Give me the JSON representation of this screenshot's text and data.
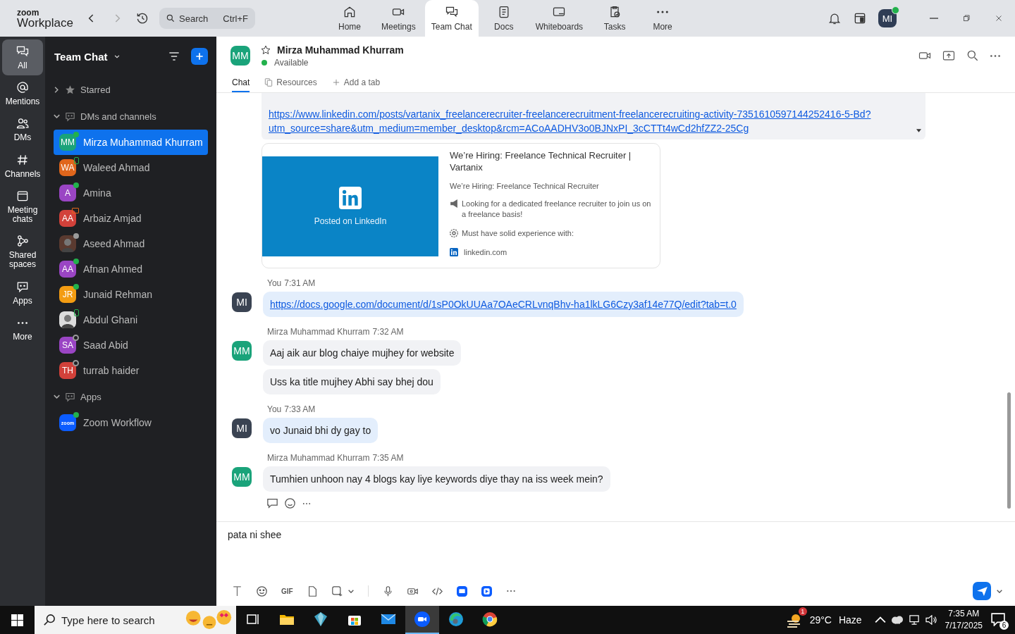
{
  "app": {
    "logo_top": "zoom",
    "logo": "Workplace",
    "search": {
      "placeholder": "Search",
      "shortcut": "Ctrl+F"
    },
    "user_initials": "MI",
    "user_online": true
  },
  "nav": [
    {
      "label": "Home",
      "selected": false
    },
    {
      "label": "Meetings",
      "selected": false
    },
    {
      "label": "Team Chat",
      "selected": true
    },
    {
      "label": "Docs",
      "selected": false
    },
    {
      "label": "Whiteboards",
      "selected": false
    },
    {
      "label": "Tasks",
      "selected": false
    },
    {
      "label": "More",
      "selected": false
    }
  ],
  "rail": [
    {
      "label": "All",
      "selected": true
    },
    {
      "label": "Mentions",
      "selected": false
    },
    {
      "label": "DMs",
      "selected": false
    },
    {
      "label": "Channels",
      "selected": false
    },
    {
      "label": "Meeting chats",
      "selected": false
    },
    {
      "label": "Shared spaces",
      "selected": false
    },
    {
      "label": "Apps",
      "selected": false
    },
    {
      "label": "More",
      "selected": false
    }
  ],
  "sidebar": {
    "title": "Team Chat",
    "sections": [
      {
        "label": "Starred",
        "expanded": false
      },
      {
        "label": "DMs and channels",
        "expanded": true,
        "items": [
          {
            "kind": "initials",
            "initials": "MM",
            "name": "Mirza Muhammad Khurram",
            "color": "#1aa37a",
            "status": {
              "kind": "dot",
              "color": "#22b14c"
            },
            "selected": true
          },
          {
            "kind": "initials",
            "initials": "WA",
            "name": "Waleed Ahmad",
            "color": "#e0661c",
            "status": {
              "kind": "phone",
              "color": "#22b14c"
            },
            "selected": false
          },
          {
            "kind": "initials",
            "initials": "A",
            "name": "Amina",
            "color": "#9a45c4",
            "status": {
              "kind": "dot",
              "color": "#22b14c"
            },
            "selected": false
          },
          {
            "kind": "initials",
            "initials": "AA",
            "name": "Arbaiz Amjad",
            "color": "#d2413a",
            "status": {
              "kind": "meeting",
              "color": "#e0661c"
            },
            "selected": false
          },
          {
            "name": "Aseed Ahmad",
            "color": "#5a3a30",
            "status": {
              "kind": "dot",
              "color": "#9a9a9a"
            },
            "selected": false
          },
          {
            "kind": "initials",
            "initials": "AA",
            "name": "Afnan Ahmed",
            "color": "#9a45c4",
            "status": {
              "kind": "dot",
              "color": "#22b14c"
            },
            "selected": false
          },
          {
            "kind": "initials",
            "initials": "JR",
            "name": "Junaid Rehman",
            "color": "#f39c12",
            "status": {
              "kind": "dot",
              "color": "#22b14c"
            },
            "selected": false
          },
          {
            "name": "Abdul Ghani",
            "color": "#dcdcdc",
            "status": {
              "kind": "phone",
              "color": "#22b14c"
            },
            "selected": false
          },
          {
            "kind": "initials",
            "initials": "SA",
            "name": "Saad Abid",
            "color": "#9a45c4",
            "status": {
              "kind": "ring",
              "color": "#9a9a9a"
            },
            "selected": false
          },
          {
            "kind": "initials",
            "initials": "TH",
            "name": "turrab haider",
            "color": "#d2413a",
            "status": {
              "kind": "ring",
              "color": "#9a9a9a"
            },
            "selected": false
          }
        ]
      },
      {
        "label": "Apps",
        "expanded": true,
        "items": [
          {
            "kind": "logo",
            "initials": "zoom",
            "name": "Zoom Workflow",
            "color": "#0b5cff",
            "status": {
              "kind": "dot",
              "color": "#22b14c"
            },
            "selected": false
          }
        ]
      }
    ]
  },
  "chat": {
    "initials": "MM",
    "name": "Mirza Muhammad Khurram",
    "starred": false,
    "status": "Available",
    "tabs": [
      {
        "label": "Chat",
        "selected": true
      },
      {
        "label": "Resources",
        "selected": false
      }
    ],
    "add_tab": "Add a tab"
  },
  "link_message": {
    "lines": [
      "https://www.linkedin.com/posts/vartanix_freelancerecruiter-freelancerecruitment-freelancerecruiting-activity-7351610597144252416-5-Bd?",
      "utm_source=share&utm_medium=member_desktop&rcm=ACoAADHV3o0BJNxPI_3cCTTt4wCd2hfZZ2-25Cg"
    ]
  },
  "preview": {
    "image_caption": "Posted on LinkedIn",
    "title": "We’re Hiring: Freelance Technical Recruiter | Vartanix",
    "subtitle": "We’re Hiring: Freelance Technical Recruiter",
    "lines": [
      "Looking for a dedicated freelance recruiter to join us on a freelance basis!",
      "Must have solid experience with:"
    ],
    "domain": "linkedin.com"
  },
  "groups": [
    {
      "sender": "You",
      "time": "7:31 AM",
      "initials": "MI",
      "mine": true,
      "messages": [
        {
          "kind": "link",
          "text": "https://docs.google.com/document/d/1sP0OkUUAa7OAeCRLvnqBhv-ha1lkLG6Czy3af14e77Q/edit?tab=t.0"
        }
      ]
    },
    {
      "sender": "Mirza Muhammad Khurram",
      "time": "7:32 AM",
      "initials": "MM",
      "mine": false,
      "messages": [
        {
          "kind": "text",
          "text": "Aaj aik aur blog chaiye mujhey for website"
        },
        {
          "kind": "text",
          "text": "Uss ka title mujhey Abhi say bhej dou"
        }
      ]
    },
    {
      "sender": "You",
      "time": "7:33 AM",
      "initials": "MI",
      "mine": true,
      "messages": [
        {
          "kind": "text",
          "text": "vo Junaid bhi dy gay to"
        }
      ]
    },
    {
      "sender": "Mirza Muhammad Khurram",
      "time": "7:35 AM",
      "initials": "MM",
      "mine": false,
      "messages": [
        {
          "kind": "text",
          "text": "Tumhien unhoon nay 4 blogs kay liye keywords diye thay na iss week mein?"
        }
      ]
    }
  ],
  "composer": {
    "value": "pata ni shee",
    "format_label": "GIF"
  },
  "taskbar": {
    "search_placeholder": "Type here to search",
    "apps": [
      {
        "selected": false
      },
      {
        "selected": false
      },
      {
        "selected": false
      },
      {
        "selected": false
      },
      {
        "selected": false
      },
      {
        "selected": true
      },
      {
        "selected": false
      },
      {
        "selected": false
      }
    ],
    "weather_badge": "1",
    "temperature": "29°C",
    "weather": "Haze",
    "time": "7:35 AM",
    "date": "7/17/2025",
    "notifications": "6"
  }
}
